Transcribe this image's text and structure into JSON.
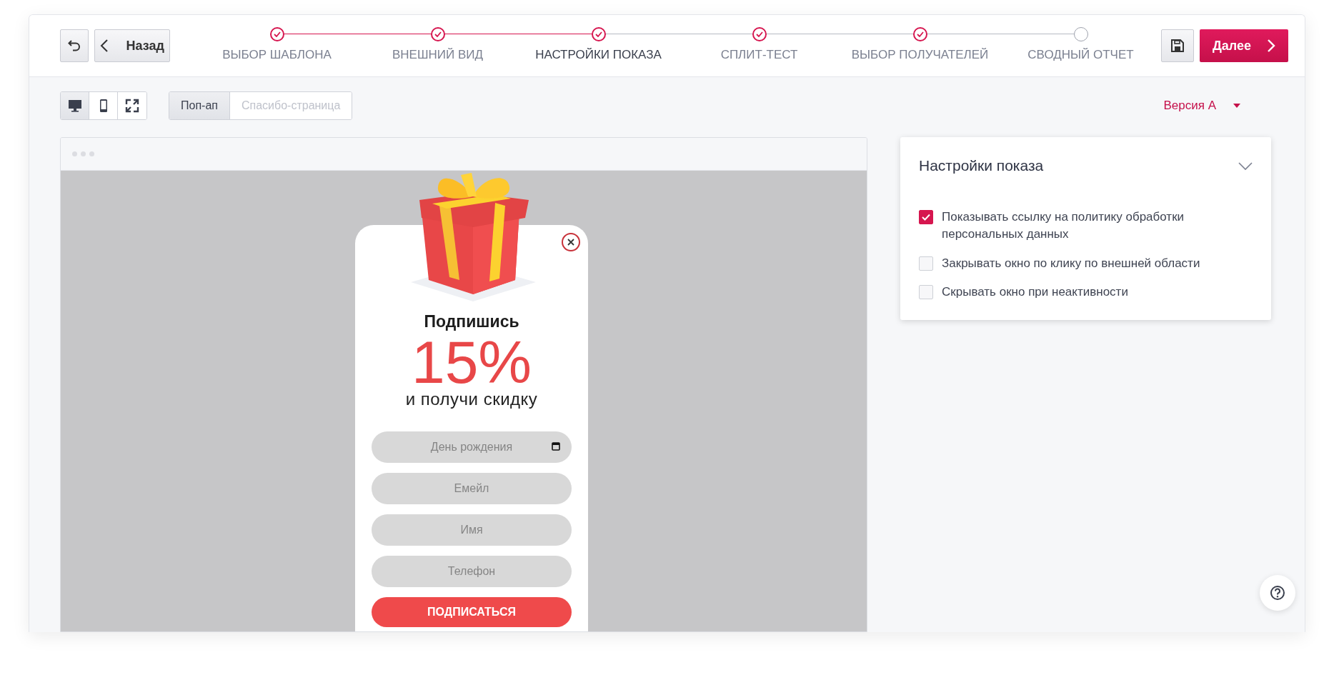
{
  "header": {
    "back_button": "Назад",
    "next_button": "Далее",
    "steps": [
      {
        "label": "ВЫБОР ШАБЛОНА",
        "done": true,
        "selected": false
      },
      {
        "label": "ВНЕШНИЙ ВИД",
        "done": true,
        "selected": false
      },
      {
        "label": "НАСТРОЙКИ ПОКАЗА",
        "done": true,
        "selected": true
      },
      {
        "label": "СПЛИТ-ТЕСТ",
        "done": true,
        "selected": false
      },
      {
        "label": "ВЫБОР ПОЛУЧАТЕЛЕЙ",
        "done": true,
        "selected": false
      },
      {
        "label": "СВОДНЫЙ ОТЧЕТ",
        "done": false,
        "selected": false
      }
    ]
  },
  "toolbar": {
    "devices": [
      {
        "kind": "desktop",
        "selected": true
      },
      {
        "kind": "mobile",
        "selected": false
      },
      {
        "kind": "fullscreen",
        "selected": false
      }
    ],
    "views": [
      {
        "label": "Поп-ап",
        "selected": true
      },
      {
        "label": "Спасибо-страница",
        "selected": false
      }
    ],
    "version": "Версия А"
  },
  "popup": {
    "title": "Подпишись",
    "discount": "15%",
    "subtitle": "и получи скидку",
    "fields": [
      {
        "placeholder": "День рождения",
        "kind": "date"
      },
      {
        "placeholder": "Емейл",
        "kind": "text"
      },
      {
        "placeholder": "Имя",
        "kind": "text"
      },
      {
        "placeholder": "Телефон",
        "kind": "text"
      }
    ],
    "submit": "ПОДПИСАТЬСЯ"
  },
  "settings": {
    "title": "Настройки показа",
    "expanded": true,
    "options": [
      {
        "label": "Показывать ссылку на политику обработки персональных данных",
        "checked": true
      },
      {
        "label": "Закрывать окно по клику по внешней области",
        "checked": false
      },
      {
        "label": "Скрывать окно при неактивности",
        "checked": false
      }
    ]
  }
}
